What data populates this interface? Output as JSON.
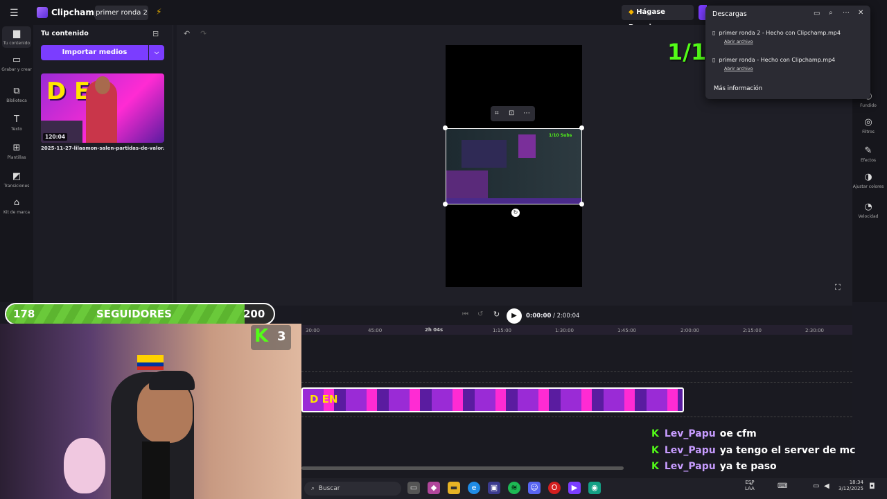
{
  "app": {
    "name": "Clipchamp",
    "project_name": "primer ronda 2",
    "premium_label": "Hágase Premium"
  },
  "left_rail": [
    {
      "label": "Tu contenido",
      "icon": "folder-icon"
    },
    {
      "label": "Grabar y crear",
      "icon": "camera-icon"
    },
    {
      "label": "Biblioteca",
      "icon": "library-icon"
    },
    {
      "label": "Texto",
      "icon": "text-icon"
    },
    {
      "label": "Plantillas",
      "icon": "templates-icon"
    },
    {
      "label": "Transiciones",
      "icon": "transitions-icon"
    },
    {
      "label": "Kit de marca",
      "icon": "brand-kit-icon"
    }
  ],
  "panel": {
    "title": "Tu contenido",
    "import_label": "Importar medios",
    "media": {
      "duration": "120:04",
      "filename": "2025-11-27-lilaamon-salen-partidas-de-valor...",
      "thumb_text": "D EN"
    }
  },
  "right_rail": [
    {
      "label": "Fundido",
      "icon": "fade-icon"
    },
    {
      "label": "Filtros",
      "icon": "filters-icon"
    },
    {
      "label": "Efectos",
      "icon": "effects-icon"
    },
    {
      "label": "Ajustar colores",
      "icon": "adjust-colors-icon"
    },
    {
      "label": "Velocidad",
      "icon": "speed-icon"
    }
  ],
  "player": {
    "current": "0:00:00",
    "separator": "/",
    "total": "2:00:04"
  },
  "timeline": {
    "zoom_label": "2h 04s",
    "ticks": [
      "30:00",
      "45:00",
      "1:15:00",
      "1:30:00",
      "1:45:00",
      "2:00:00",
      "2:15:00",
      "2:30:00"
    ],
    "clip_text": "D EN"
  },
  "downloads": {
    "title": "Descargas",
    "items": [
      {
        "name": "primer ronda 2 - Hecho con Clipchamp.mp4",
        "link": "Abrir archivo"
      },
      {
        "name": "primer ronda - Hecho con Clipchamp.mp4",
        "link": "Abrir archivo"
      }
    ],
    "more": "Más información"
  },
  "overlay": {
    "subs_goal": "1/10 Subs",
    "followers_current": "178",
    "followers_label": "SEGUIDORES",
    "followers_goal": "200",
    "followers_progress": 0.89,
    "kick_count": "3"
  },
  "chat": [
    {
      "user": "Lev_Papu",
      "message": "oe cfm"
    },
    {
      "user": "Lev_Papu",
      "message": "ya tengo el server de mc"
    },
    {
      "user": "Lev_Papu",
      "message": "ya te paso"
    }
  ],
  "taskbar": {
    "search_placeholder": "Buscar",
    "lang": "ESP",
    "lang2": "LAA",
    "time": "18:34",
    "date": "3/12/2025"
  },
  "colors": {
    "accent": "#7b3dff",
    "kick_green": "#53fc18",
    "chat_user": "#c79cff"
  }
}
